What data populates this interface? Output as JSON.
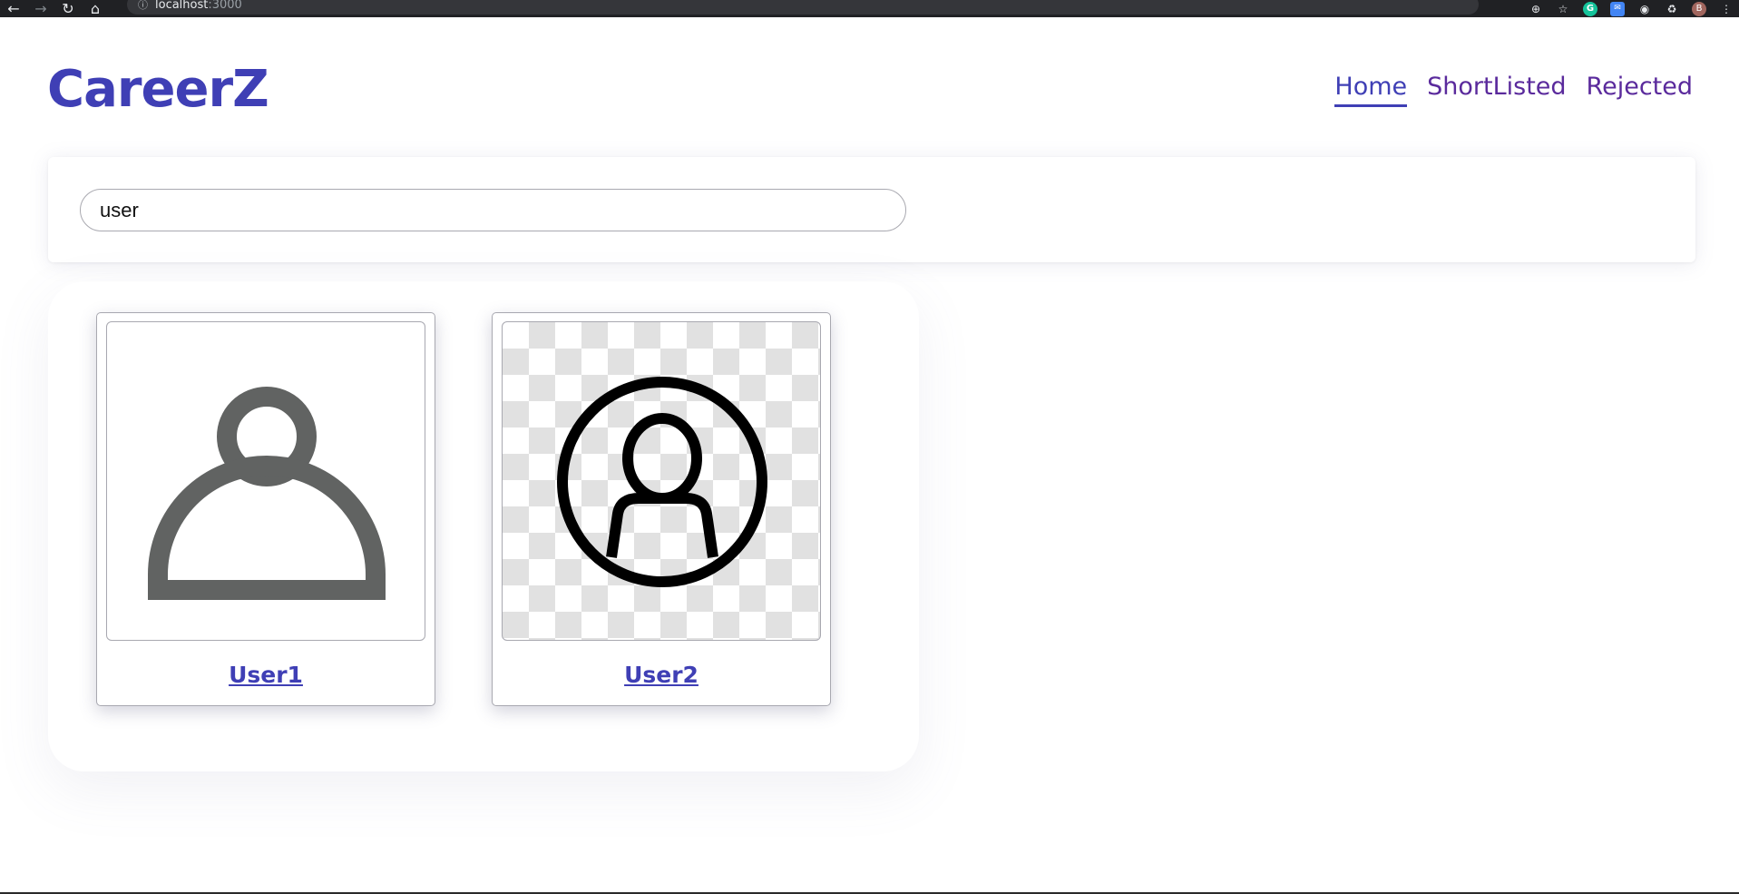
{
  "browser": {
    "url_host": "localhost",
    "url_port": ":3000",
    "avatar_initial": "B",
    "extension_grammarly": "G"
  },
  "header": {
    "brand": "CareerZ",
    "nav": [
      {
        "label": "Home",
        "active": true
      },
      {
        "label": "ShortListed",
        "active": false
      },
      {
        "label": "Rejected",
        "active": false
      }
    ]
  },
  "search": {
    "value": "user"
  },
  "results": [
    {
      "name": "User1",
      "avatar_icon": "person-outline-icon"
    },
    {
      "name": "User2",
      "avatar_icon": "person-circle-icon"
    }
  ],
  "colors": {
    "brand": "#3f3fb5",
    "nav": "#5a2a9c",
    "icon_gray": "#616362",
    "icon_black": "#000000"
  }
}
